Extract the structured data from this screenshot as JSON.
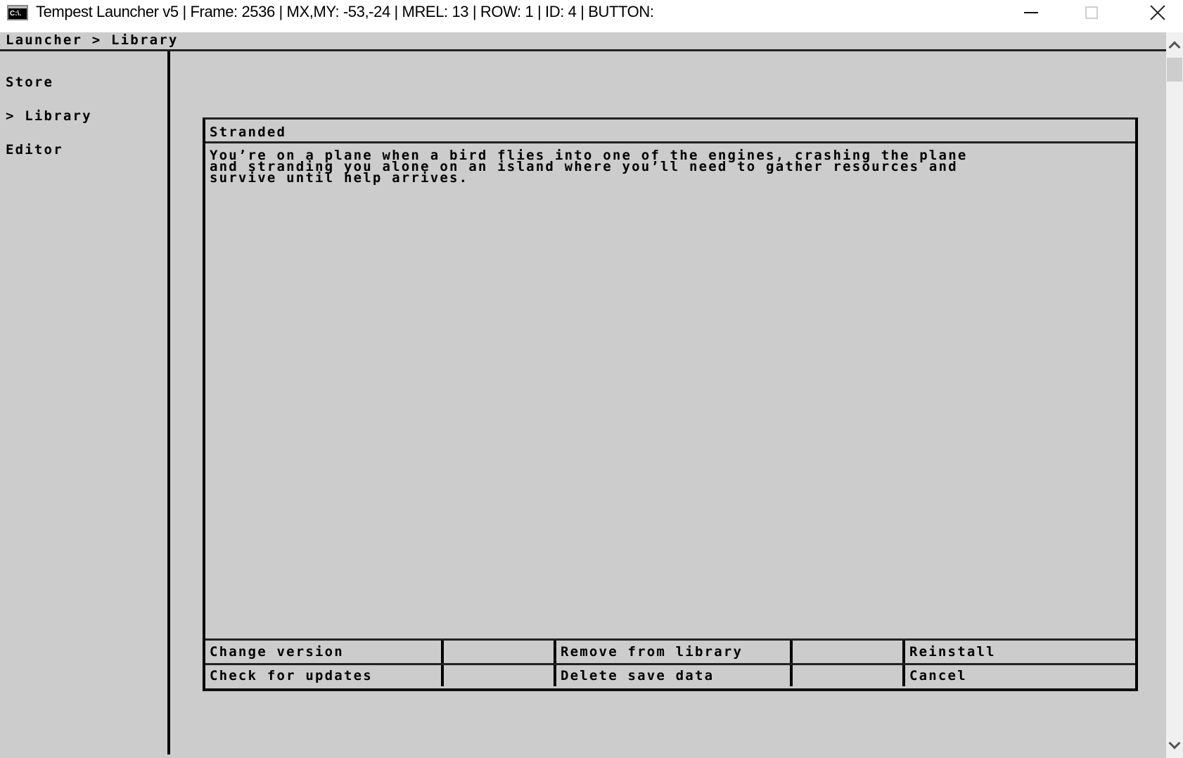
{
  "window": {
    "icon": "console-icon",
    "icon_text": "C:\\.",
    "title": "Tempest Launcher v5 | Frame: 2536 | MX,MY: -53,-24 | MREL: 13 | ROW: 1 | ID: 4 | BUTTON:",
    "controls": {
      "minimize": "minimize-icon",
      "maximize": "maximize-icon",
      "close": "close-icon"
    }
  },
  "breadcrumb": "Launcher > Library",
  "sidebar": {
    "items": [
      {
        "label": "Store",
        "selected": false
      },
      {
        "label": "> Library",
        "selected": true
      },
      {
        "label": "Editor",
        "selected": false
      }
    ]
  },
  "dialog": {
    "title": "Stranded",
    "description": "You’re on a plane when a bird flies into one of the engines, crashing the plane\nand stranding you alone on an island where you’ll need to gather resources and\nsurvive until help arrives.",
    "buttons": {
      "row1": [
        "Change version",
        "",
        "Remove from library",
        "",
        "Reinstall"
      ],
      "row2": [
        "Check for updates",
        "",
        "Delete save data",
        "",
        "Cancel"
      ]
    }
  },
  "scrollbar": {
    "up": "chevron-up-icon",
    "down": "chevron-down-icon"
  }
}
